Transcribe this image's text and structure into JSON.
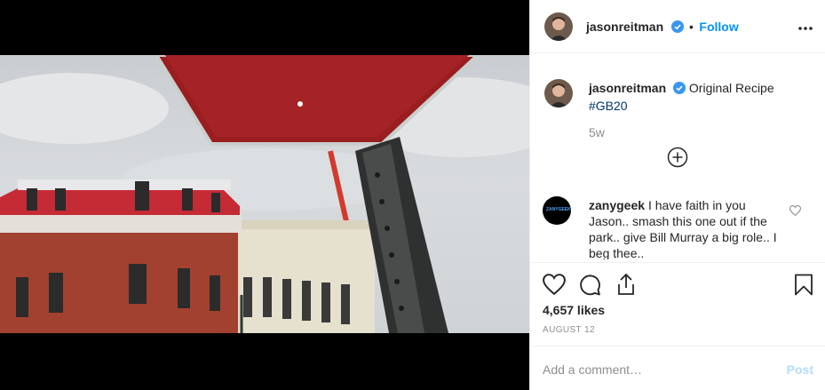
{
  "post": {
    "author": "jasonreitman",
    "follow_label": "Follow",
    "separator": "•",
    "caption_text": "Original Recipe",
    "hashtag": "#GB20",
    "time_ago": "5w",
    "more_options_icon": "more-horizontal-icon",
    "load_more_icon": "plus-circle-icon"
  },
  "comments": [
    {
      "author": "zanygeek",
      "text": "I have faith in you Jason.. smash this one out if the park.. give Bill Murray a big role.. I beg thee..",
      "avatar_text": "ZANYGEEK"
    }
  ],
  "actions": {
    "like_icon": "heart-icon",
    "comment_icon": "comment-icon",
    "share_icon": "share-icon",
    "save_icon": "bookmark-icon"
  },
  "likes": "4,657 likes",
  "date": "AUGUST 12",
  "add_comment": {
    "placeholder": "Add a comment…",
    "post_label": "Post"
  },
  "colors": {
    "accent": "#0095f6",
    "hashtag": "#00376b",
    "muted": "#8e8e8e",
    "post_disabled": "#b2dffc"
  }
}
